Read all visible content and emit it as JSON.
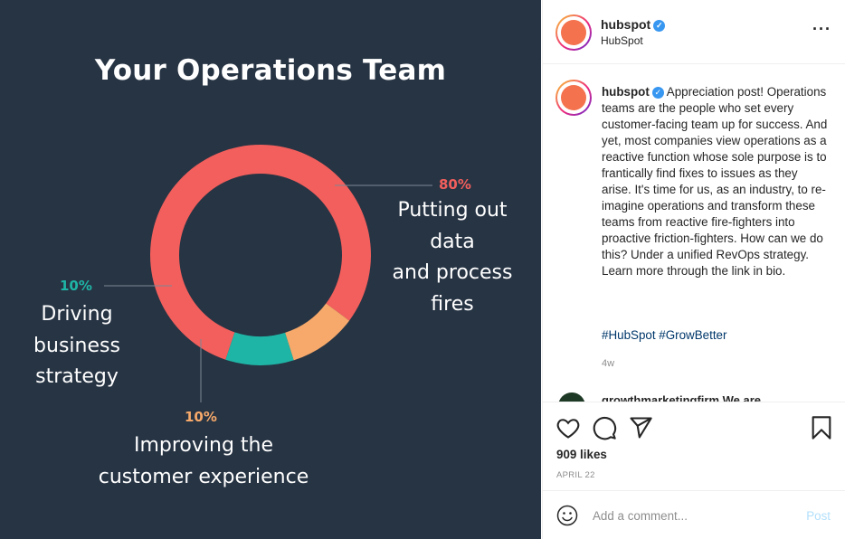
{
  "slide": {
    "title": "Your Operations Team",
    "colors": {
      "background": "#273444",
      "red": "#f25f5c",
      "teal": "#1fb5a6",
      "orange": "#f6a96a"
    }
  },
  "chart_data": {
    "type": "pie",
    "title": "Your Operations Team",
    "slices": [
      {
        "label": "Putting out data and process fires",
        "value": 80,
        "display": "80%",
        "color": "#f25f5c"
      },
      {
        "label": "Improving the customer experience",
        "value": 10,
        "display": "10%",
        "color": "#f6a96a"
      },
      {
        "label": "Driving business strategy",
        "value": 10,
        "display": "10%",
        "color": "#1fb5a6"
      }
    ]
  },
  "post": {
    "username": "hubspot",
    "display_name": "HubSpot",
    "more_icon": "ellipsis-icon",
    "caption": "Appreciation post! Operations teams are the people who set every customer-facing team up for success. And yet, most companies view operations as a reactive function whose sole purpose is to frantically find fixes to issues as they arise. It's time for us, as an industry, to re-imagine operations and transform these teams from reactive fire-fighters into proactive friction-fighters. How can we do this? Under a unified RevOps strategy. Learn more through the link in bio.",
    "hashtags": "#HubSpot #GrowBetter",
    "age": "4w",
    "next_comment": "growthmarketingfirm We are",
    "likes": "909 likes",
    "date": "APRIL 22",
    "comment_placeholder": "Add a comment...",
    "post_label": "Post"
  }
}
